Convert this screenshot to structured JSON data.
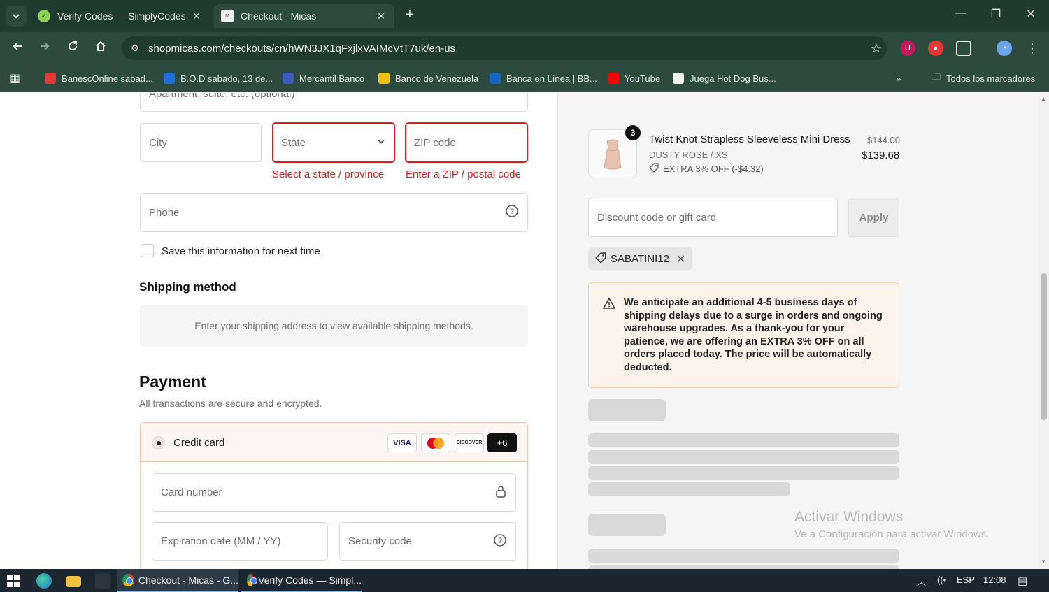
{
  "browser": {
    "tabs": [
      {
        "title": "Verify Codes — SimplyCodes",
        "active": false
      },
      {
        "title": "Checkout - Micas",
        "active": true
      }
    ],
    "url": "shopmicas.com/checkouts/cn/hWN3JX1qFxjlxVAIMcVtT7uk/en-us",
    "bookmarks": [
      "BanescOnline sabad...",
      "B.O.D sabado, 13 de...",
      "Mercantil Banco",
      "Banco de Venezuela",
      "Banca en Línea | BB...",
      "YouTube",
      "Juega Hot Dog Bus..."
    ],
    "all_bookmarks": "Todos los marcadores",
    "overflow": "»"
  },
  "checkout": {
    "apartment_placeholder": "Apartment, suite, etc. (optional)",
    "city_placeholder": "City",
    "state_placeholder": "State",
    "state_error": "Select a state / province",
    "zip_placeholder": "ZIP code",
    "zip_error": "Enter a ZIP / postal code",
    "phone_placeholder": "Phone",
    "save_info_label": "Save this information for next time",
    "shipping_heading": "Shipping method",
    "shipping_message": "Enter your shipping address to view available shipping methods.",
    "payment_heading": "Payment",
    "payment_subtitle": "All transactions are secure and encrypted.",
    "credit_card_label": "Credit card",
    "card_brands": [
      "VISA",
      "Mastercard",
      "DISCOVER"
    ],
    "more_brands": "+6",
    "card_number_placeholder": "Card number",
    "expiration_placeholder": "Expiration date (MM / YY)",
    "security_code_placeholder": "Security code"
  },
  "summary": {
    "quantity": "3",
    "product_name": "Twist Knot Strapless Sleeveless Mini Dress",
    "variant": "DUSTY ROSE / XS",
    "discount_note": "EXTRA 3% OFF (-$4.32)",
    "original_price": "$144.00",
    "price": "$139.68",
    "discount_placeholder": "Discount code or gift card",
    "apply_label": "Apply",
    "applied_code": "SABATINI12",
    "notice": "We anticipate an additional 4-5 business days of shipping delays due to a surge in orders and ongoing warehouse upgrades. As a thank-you for your patience, we are offering an EXTRA 3% OFF on all orders placed today. The price will be automatically deducted."
  },
  "watermark": {
    "title": "Activar Windows",
    "subtitle": "Ve a Configuración para activar Windows."
  },
  "taskbar": {
    "apps": [
      "Checkout - Micas - G...",
      "Verify Codes — Simpl..."
    ],
    "language": "ESP",
    "time": "12:08"
  },
  "colors": {
    "error": "#dd1d1d",
    "browser_frame": "#1f3a2f",
    "notice_bg": "#fdf3ea"
  }
}
